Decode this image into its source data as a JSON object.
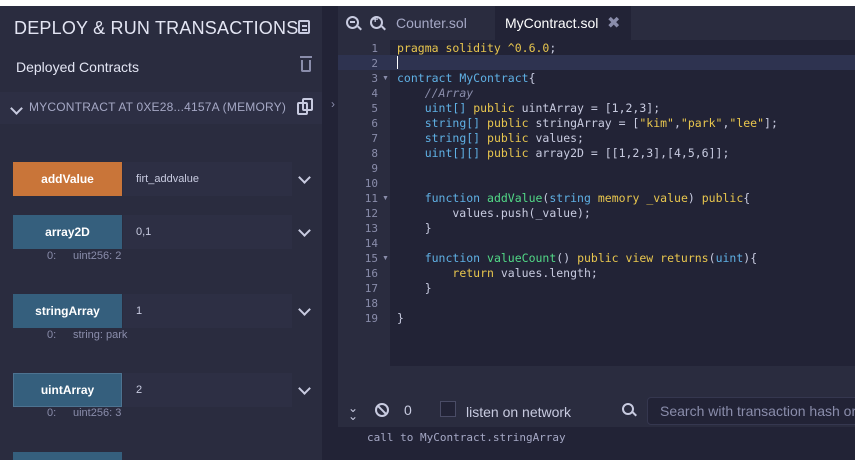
{
  "panel": {
    "title": "DEPLOY & RUN TRANSACTIONS",
    "deployed_label": "Deployed Contracts",
    "contract_name": "MYCONTRACT AT 0XE28...4157A (MEMORY)"
  },
  "functions": [
    {
      "label": "addValue",
      "input": "firt_addvalue",
      "kind": "transact"
    },
    {
      "label": "array2D",
      "input": "0,1",
      "kind": "call",
      "result_index": "0:",
      "result_value": "uint256: 2"
    },
    {
      "label": "stringArray",
      "input": "1",
      "kind": "call",
      "result_index": "0:",
      "result_value": "string: park"
    },
    {
      "label": "uintArray",
      "input": "2",
      "kind": "call",
      "result_index": "0:",
      "result_value": "uint256: 3"
    }
  ],
  "editor": {
    "tabs": [
      {
        "label": "Counter.sol",
        "active": false
      },
      {
        "label": "MyContract.sol",
        "active": true
      }
    ],
    "line_numbers": [
      "1",
      "2",
      "3",
      "4",
      "5",
      "6",
      "7",
      "8",
      "9",
      "10",
      "11",
      "12",
      "13",
      "14",
      "15",
      "16",
      "17",
      "18",
      "19"
    ]
  },
  "terminal": {
    "pending_count": "0",
    "listen_label": "listen on network",
    "search_placeholder": "Search with transaction hash or address",
    "log_line": "call to MyContract.stringArray"
  },
  "colors": {
    "transact_button": "#c97539",
    "call_button": "#355f7d",
    "background": "#222336",
    "panel": "#2a2c3f"
  }
}
